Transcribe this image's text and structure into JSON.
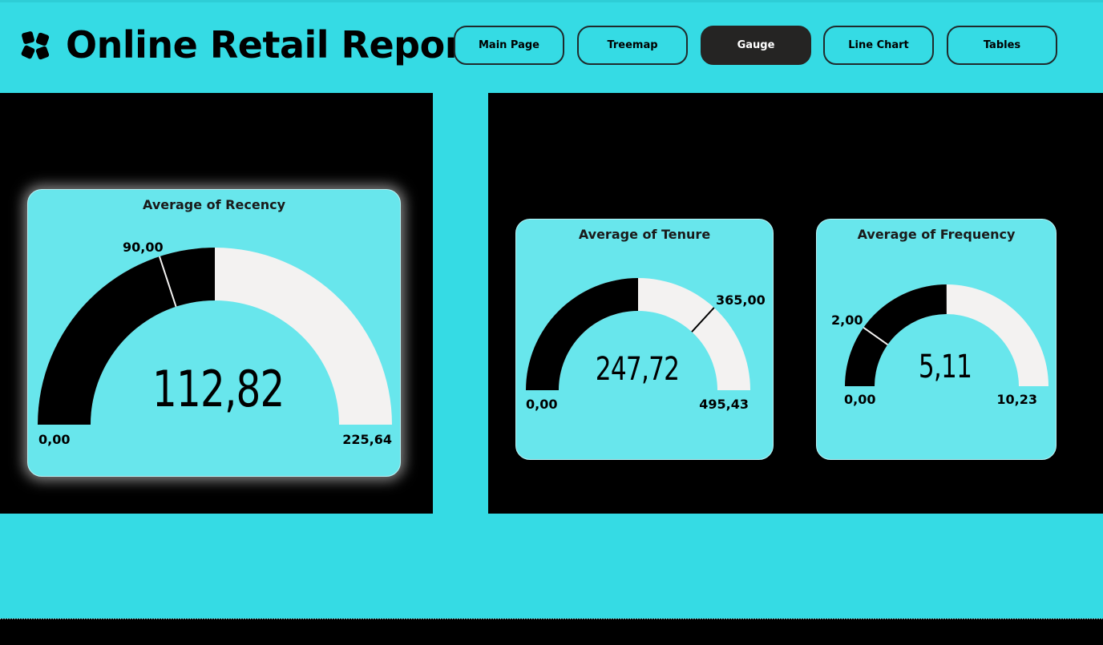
{
  "header": {
    "title": "Online Retail Report",
    "nav": [
      {
        "label": "Main Page",
        "active": false
      },
      {
        "label": "Treemap",
        "active": false
      },
      {
        "label": "Gauge",
        "active": true
      },
      {
        "label": "Line Chart",
        "active": false
      },
      {
        "label": "Tables",
        "active": false
      }
    ]
  },
  "colors": {
    "background": "#35dbe4",
    "card": "#68e6ec",
    "gauge_fill": "#000000",
    "gauge_track": "#f3f2f1",
    "active_button": "#252423"
  },
  "gauges": [
    {
      "title": "Average of Recency",
      "value": 112.82,
      "value_label": "112,82",
      "min_label": "0,00",
      "max_label": "225,64",
      "target_label": "90,00",
      "min": 0,
      "max": 225.64,
      "target": 90
    },
    {
      "title": "Average of Tenure",
      "value": 247.72,
      "value_label": "247,72",
      "min_label": "0,00",
      "max_label": "495,43",
      "target_label": "365,00",
      "min": 0,
      "max": 495.43,
      "target": 365
    },
    {
      "title": "Average of Frequency",
      "value": 5.11,
      "value_label": "5,11",
      "min_label": "0,00",
      "max_label": "10,23",
      "target_label": "2,00",
      "min": 0,
      "max": 10.23,
      "target": 2
    }
  ]
}
